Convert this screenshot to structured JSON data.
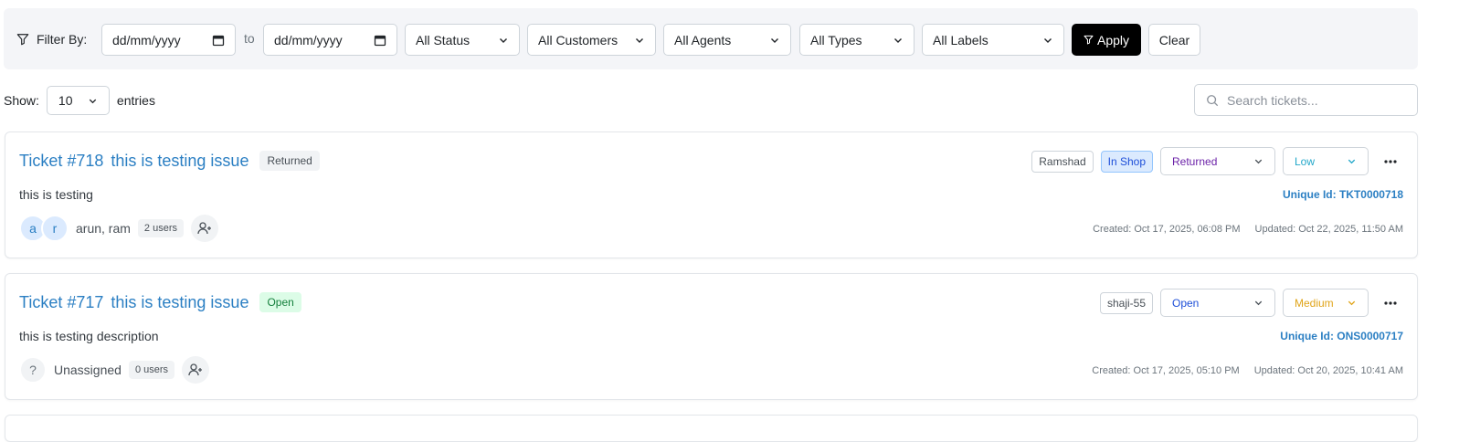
{
  "filter": {
    "label": "Filter By:",
    "date_from_placeholder": "dd/mm/yyyy",
    "to": "to",
    "date_to_placeholder": "dd/mm/yyyy",
    "status": "All Status",
    "customers": "All Customers",
    "agents": "All Agents",
    "types": "All Types",
    "labels": "All Labels",
    "apply": "Apply",
    "clear": "Clear"
  },
  "list": {
    "show_label": "Show:",
    "show_value": "10",
    "entries_label": "entries",
    "search_placeholder": "Search tickets..."
  },
  "tickets": [
    {
      "number": "Ticket #718",
      "title": "this is testing issue",
      "status_badge": "Returned",
      "description": "this is testing",
      "customer_tag": "Ramshad",
      "location_tag": "In Shop",
      "status_select": "Returned",
      "priority_select": "Low",
      "unique_id": "Unique Id: TKT0000718",
      "avatars": [
        "a",
        "r"
      ],
      "assignees": "arun, ram",
      "user_count": "2 users",
      "created": "Created: Oct 17, 2025, 06:08 PM",
      "updated": "Updated: Oct 22, 2025, 11:50 AM"
    },
    {
      "number": "Ticket #717",
      "title": "this is testing issue",
      "status_badge": "Open",
      "description": "this is testing description",
      "customer_tag": "shaji-55",
      "status_select": "Open",
      "priority_select": "Medium",
      "unique_id": "Unique Id: ONS0000717",
      "avatars": [
        "?"
      ],
      "assignees": "Unassigned",
      "user_count": "0 users",
      "created": "Created: Oct 17, 2025, 05:10 PM",
      "updated": "Updated: Oct 20, 2025, 10:41 AM"
    }
  ],
  "colors": {
    "accent_blue": "#2b7fc3",
    "returned_purple": "#6b21a8",
    "open_blue": "#1d4ed8",
    "low_cyan": "#22a7c9",
    "medium_amber": "#e0a419",
    "open_green": "#15803d"
  }
}
